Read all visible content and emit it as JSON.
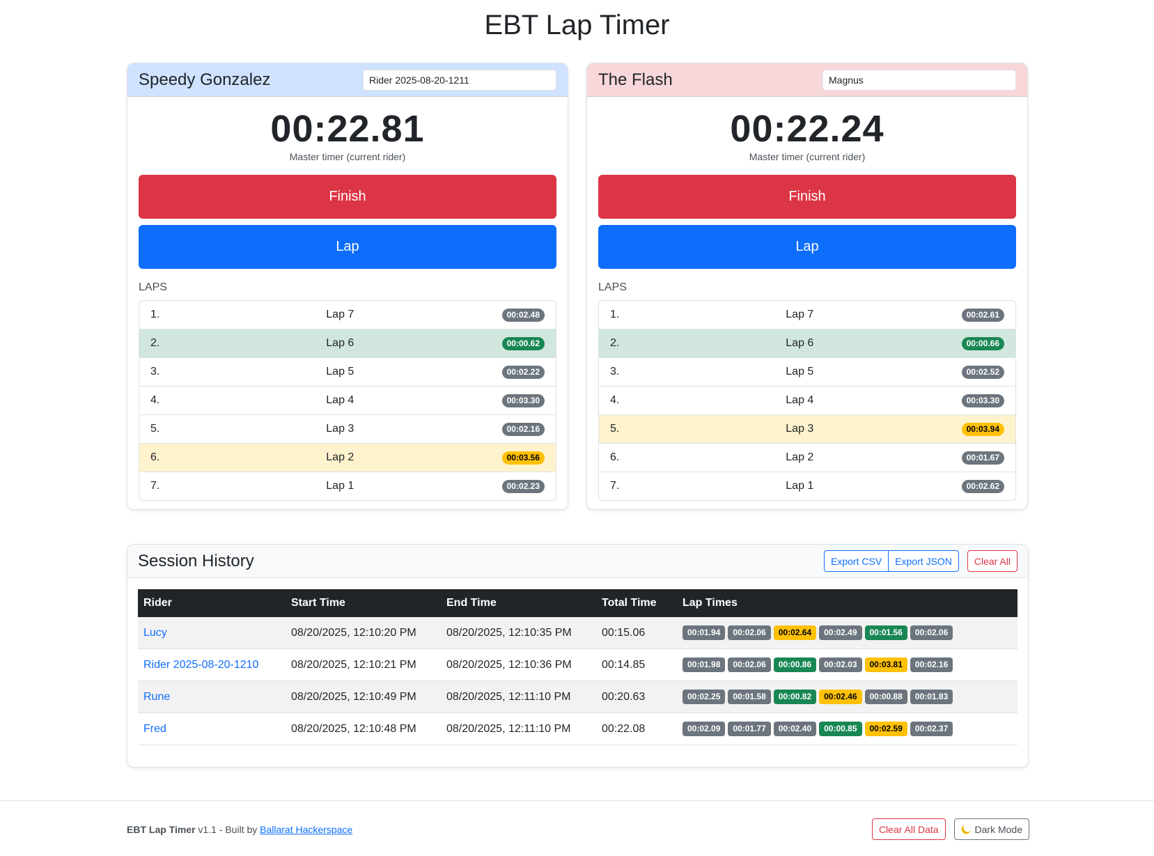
{
  "app_title": "EBT Lap Timer",
  "riders": [
    {
      "name": "Speedy Gonzalez",
      "input_value": "Rider 2025-08-20-1211",
      "timer": "00:22.81",
      "timer_caption": "Master timer (current rider)",
      "finish_label": "Finish",
      "lap_label": "Lap",
      "laps_heading": "LAPS",
      "laps": [
        {
          "num": "1.",
          "label": "Lap 7",
          "time": "00:02.48",
          "status": "normal"
        },
        {
          "num": "2.",
          "label": "Lap 6",
          "time": "00:00.62",
          "status": "fast"
        },
        {
          "num": "3.",
          "label": "Lap 5",
          "time": "00:02.22",
          "status": "normal"
        },
        {
          "num": "4.",
          "label": "Lap 4",
          "time": "00:03.30",
          "status": "normal"
        },
        {
          "num": "5.",
          "label": "Lap 3",
          "time": "00:02.16",
          "status": "normal"
        },
        {
          "num": "6.",
          "label": "Lap 2",
          "time": "00:03.56",
          "status": "slow"
        },
        {
          "num": "7.",
          "label": "Lap 1",
          "time": "00:02.23",
          "status": "normal"
        }
      ]
    },
    {
      "name": "The Flash",
      "input_value": "Magnus",
      "timer": "00:22.24",
      "timer_caption": "Master timer (current rider)",
      "finish_label": "Finish",
      "lap_label": "Lap",
      "laps_heading": "LAPS",
      "laps": [
        {
          "num": "1.",
          "label": "Lap 7",
          "time": "00:02.61",
          "status": "normal"
        },
        {
          "num": "2.",
          "label": "Lap 6",
          "time": "00:00.66",
          "status": "fast"
        },
        {
          "num": "3.",
          "label": "Lap 5",
          "time": "00:02.52",
          "status": "normal"
        },
        {
          "num": "4.",
          "label": "Lap 4",
          "time": "00:03.30",
          "status": "normal"
        },
        {
          "num": "5.",
          "label": "Lap 3",
          "time": "00:03.94",
          "status": "slow"
        },
        {
          "num": "6.",
          "label": "Lap 2",
          "time": "00:01.67",
          "status": "normal"
        },
        {
          "num": "7.",
          "label": "Lap 1",
          "time": "00:02.62",
          "status": "normal"
        }
      ]
    }
  ],
  "history": {
    "title": "Session History",
    "export_csv_label": "Export CSV",
    "export_json_label": "Export JSON",
    "clear_all_label": "Clear All",
    "columns": [
      "Rider",
      "Start Time",
      "End Time",
      "Total Time",
      "Lap Times"
    ],
    "rows": [
      {
        "rider": "Lucy",
        "start": "08/20/2025, 12:10:20 PM",
        "end": "08/20/2025, 12:10:35 PM",
        "total": "00:15.06",
        "laps": [
          {
            "t": "00:01.94",
            "s": "normal"
          },
          {
            "t": "00:02.06",
            "s": "normal"
          },
          {
            "t": "00:02.64",
            "s": "slow"
          },
          {
            "t": "00:02.49",
            "s": "normal"
          },
          {
            "t": "00:01.56",
            "s": "fast"
          },
          {
            "t": "00:02.06",
            "s": "normal"
          }
        ]
      },
      {
        "rider": "Rider 2025-08-20-1210",
        "start": "08/20/2025, 12:10:21 PM",
        "end": "08/20/2025, 12:10:36 PM",
        "total": "00:14.85",
        "laps": [
          {
            "t": "00:01.98",
            "s": "normal"
          },
          {
            "t": "00:02.06",
            "s": "normal"
          },
          {
            "t": "00:00.86",
            "s": "fast"
          },
          {
            "t": "00:02.03",
            "s": "normal"
          },
          {
            "t": "00:03.81",
            "s": "slow"
          },
          {
            "t": "00:02.16",
            "s": "normal"
          }
        ]
      },
      {
        "rider": "Rune",
        "start": "08/20/2025, 12:10:49 PM",
        "end": "08/20/2025, 12:11:10 PM",
        "total": "00:20.63",
        "laps": [
          {
            "t": "00:02.25",
            "s": "normal"
          },
          {
            "t": "00:01.58",
            "s": "normal"
          },
          {
            "t": "00:00.82",
            "s": "fast"
          },
          {
            "t": "00:02.46",
            "s": "slow"
          },
          {
            "t": "00:00.88",
            "s": "normal"
          },
          {
            "t": "00:01.83",
            "s": "normal"
          }
        ]
      },
      {
        "rider": "Fred",
        "start": "08/20/2025, 12:10:48 PM",
        "end": "08/20/2025, 12:11:10 PM",
        "total": "00:22.08",
        "laps": [
          {
            "t": "00:02.09",
            "s": "normal"
          },
          {
            "t": "00:01.77",
            "s": "normal"
          },
          {
            "t": "00:02.40",
            "s": "normal"
          },
          {
            "t": "00:00.85",
            "s": "fast"
          },
          {
            "t": "00:02.59",
            "s": "slow"
          },
          {
            "t": "00:02.37",
            "s": "normal"
          }
        ]
      }
    ]
  },
  "footer": {
    "app_name": "EBT Lap Timer",
    "version_text": " v1.1 - Built by ",
    "link_text": "Ballarat Hackerspace",
    "clear_all_data_label": "Clear All Data",
    "dark_mode_label": "Dark Mode",
    "dark_mode_icon": "moon-icon"
  },
  "colors": {
    "primary": "#0d6efd",
    "danger": "#dc3545",
    "success": "#198754",
    "warning": "#ffc107",
    "secondary": "#6c757d",
    "header_blue": "#cfe2ff",
    "header_red": "#f8d7da"
  }
}
